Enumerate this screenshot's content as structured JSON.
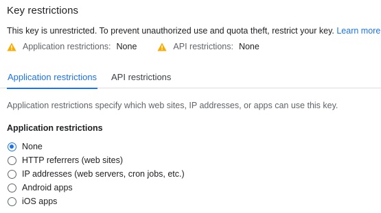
{
  "key_restrictions": {
    "title": "Key restrictions",
    "description": "This key is unrestricted. To prevent unauthorized use and quota theft, restrict your key.",
    "learn_more": "Learn more",
    "warnings": [
      {
        "icon": "warning-icon",
        "label": "Application restrictions:",
        "value": "None"
      },
      {
        "icon": "warning-icon",
        "label": "API restrictions:",
        "value": "None"
      }
    ]
  },
  "tabs": [
    {
      "label": "Application restrictions",
      "active": true
    },
    {
      "label": "API restrictions",
      "active": false
    }
  ],
  "application_restrictions": {
    "helper": "Application restrictions specify which web sites, IP addresses, or apps can use this key.",
    "group_title": "Application restrictions",
    "options": [
      {
        "label": "None",
        "selected": true
      },
      {
        "label": "HTTP referrers (web sites)",
        "selected": false
      },
      {
        "label": "IP addresses (web servers, cron jobs, etc.)",
        "selected": false
      },
      {
        "label": "Android apps",
        "selected": false
      },
      {
        "label": "iOS apps",
        "selected": false
      }
    ]
  },
  "colors": {
    "accent": "#1a73e8",
    "warning": "#f9ab00",
    "text": "#202124",
    "secondary_text": "#5f6368"
  }
}
